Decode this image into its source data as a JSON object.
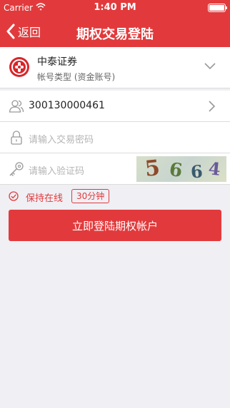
{
  "status_bar": {
    "carrier": "Carrier",
    "time": "1:40 PM"
  },
  "nav": {
    "back_label": "返回",
    "title": "期权交易登陆"
  },
  "broker": {
    "name": "中泰证券",
    "account_type": "帐号类型 (资金账号)"
  },
  "account": {
    "value": "300130000461"
  },
  "password": {
    "placeholder": "请输入交易密码"
  },
  "captcha": {
    "placeholder": "请输入验证码",
    "code": [
      "5",
      "6",
      "6",
      "4"
    ]
  },
  "keep_online": {
    "label": "保持在线",
    "duration": "30分钟"
  },
  "login_button": "立即登陆期权帐户",
  "colors": {
    "primary": "#e23a3c",
    "background": "#efeff4"
  }
}
